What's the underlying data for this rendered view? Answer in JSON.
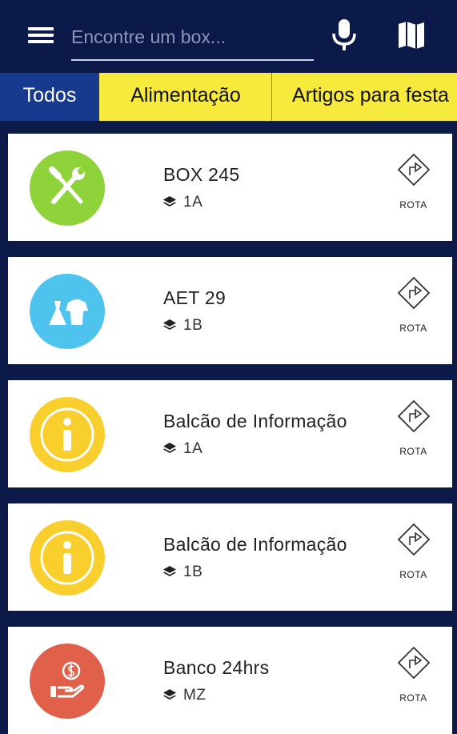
{
  "search": {
    "placeholder": "Encontre um box..."
  },
  "icons": {
    "menu": "menu-icon",
    "mic": "microphone-icon",
    "map": "map-icon",
    "floor": "layers-icon",
    "route": "route-icon"
  },
  "tabs": [
    {
      "label": "Todos",
      "active": true
    },
    {
      "label": "Alimentação",
      "active": false
    },
    {
      "label": "Artigos para festa",
      "active": false
    }
  ],
  "colors": {
    "header": "#0c1a4a",
    "tab_bar": "#f7ea3c",
    "tab_active": "#173a8f",
    "green": "#8fd33a",
    "blue": "#4dc3ee",
    "yellow": "#f9cf2e",
    "red": "#e0604a"
  },
  "items": [
    {
      "title": "BOX 245",
      "floor": "1A",
      "icon": "tools-icon",
      "color": "#8fd33a",
      "route_label": "ROTA"
    },
    {
      "title": "AET 29",
      "floor": "1B",
      "icon": "clothing-icon",
      "color": "#4dc3ee",
      "route_label": "ROTA"
    },
    {
      "title": "Balcão de Informação",
      "floor": "1A",
      "icon": "info-icon",
      "color": "#f9cf2e",
      "route_label": "ROTA"
    },
    {
      "title": "Balcão de Informação",
      "floor": "1B",
      "icon": "info-icon",
      "color": "#f9cf2e",
      "route_label": "ROTA"
    },
    {
      "title": "Banco 24hrs",
      "floor": "MZ",
      "icon": "money-hand-icon",
      "color": "#e0604a",
      "route_label": "ROTA"
    }
  ]
}
